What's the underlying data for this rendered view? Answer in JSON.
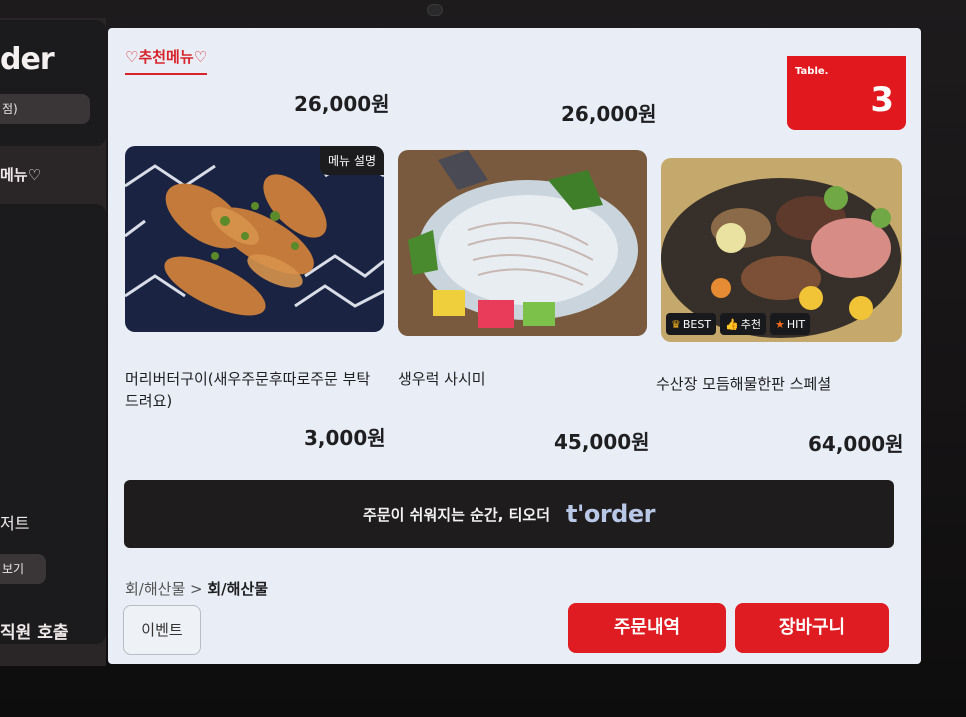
{
  "sidebar": {
    "logo": "der",
    "pill": "점)",
    "menu_label": "메뉴♡",
    "dessert": "저트",
    "view_btn": "보기",
    "call_staff": "직원 호출"
  },
  "section": {
    "title": "♡추천메뉴♡"
  },
  "table": {
    "label": "Table.",
    "number": "3"
  },
  "top_prices": [
    "26,000원",
    "26,000원"
  ],
  "menu_items": [
    {
      "name": "머리버터구이(새우주문후따로주문 부탁드려요)",
      "price": "3,000원",
      "desc_button": "메뉴 설명"
    },
    {
      "name": "생우럭 사시미",
      "price": "45,000원"
    },
    {
      "name": "수산장 모듬해물한판 스페셜",
      "price": "64,000원",
      "badges": [
        "BEST",
        "추천",
        "HIT"
      ]
    }
  ],
  "banner": {
    "slogan": "주문이 쉬워지는 순간, 티오더",
    "brand": "t'order"
  },
  "breadcrumb": {
    "parent": "회/해산물",
    "separator": " > ",
    "current": "회/해산물"
  },
  "buttons": {
    "event": "이벤트",
    "order_history": "주문내역",
    "cart": "장바구니"
  },
  "colors": {
    "accent": "#e1191e",
    "banner": "#1e1c1d",
    "screen_bg": "#e9eef6"
  }
}
